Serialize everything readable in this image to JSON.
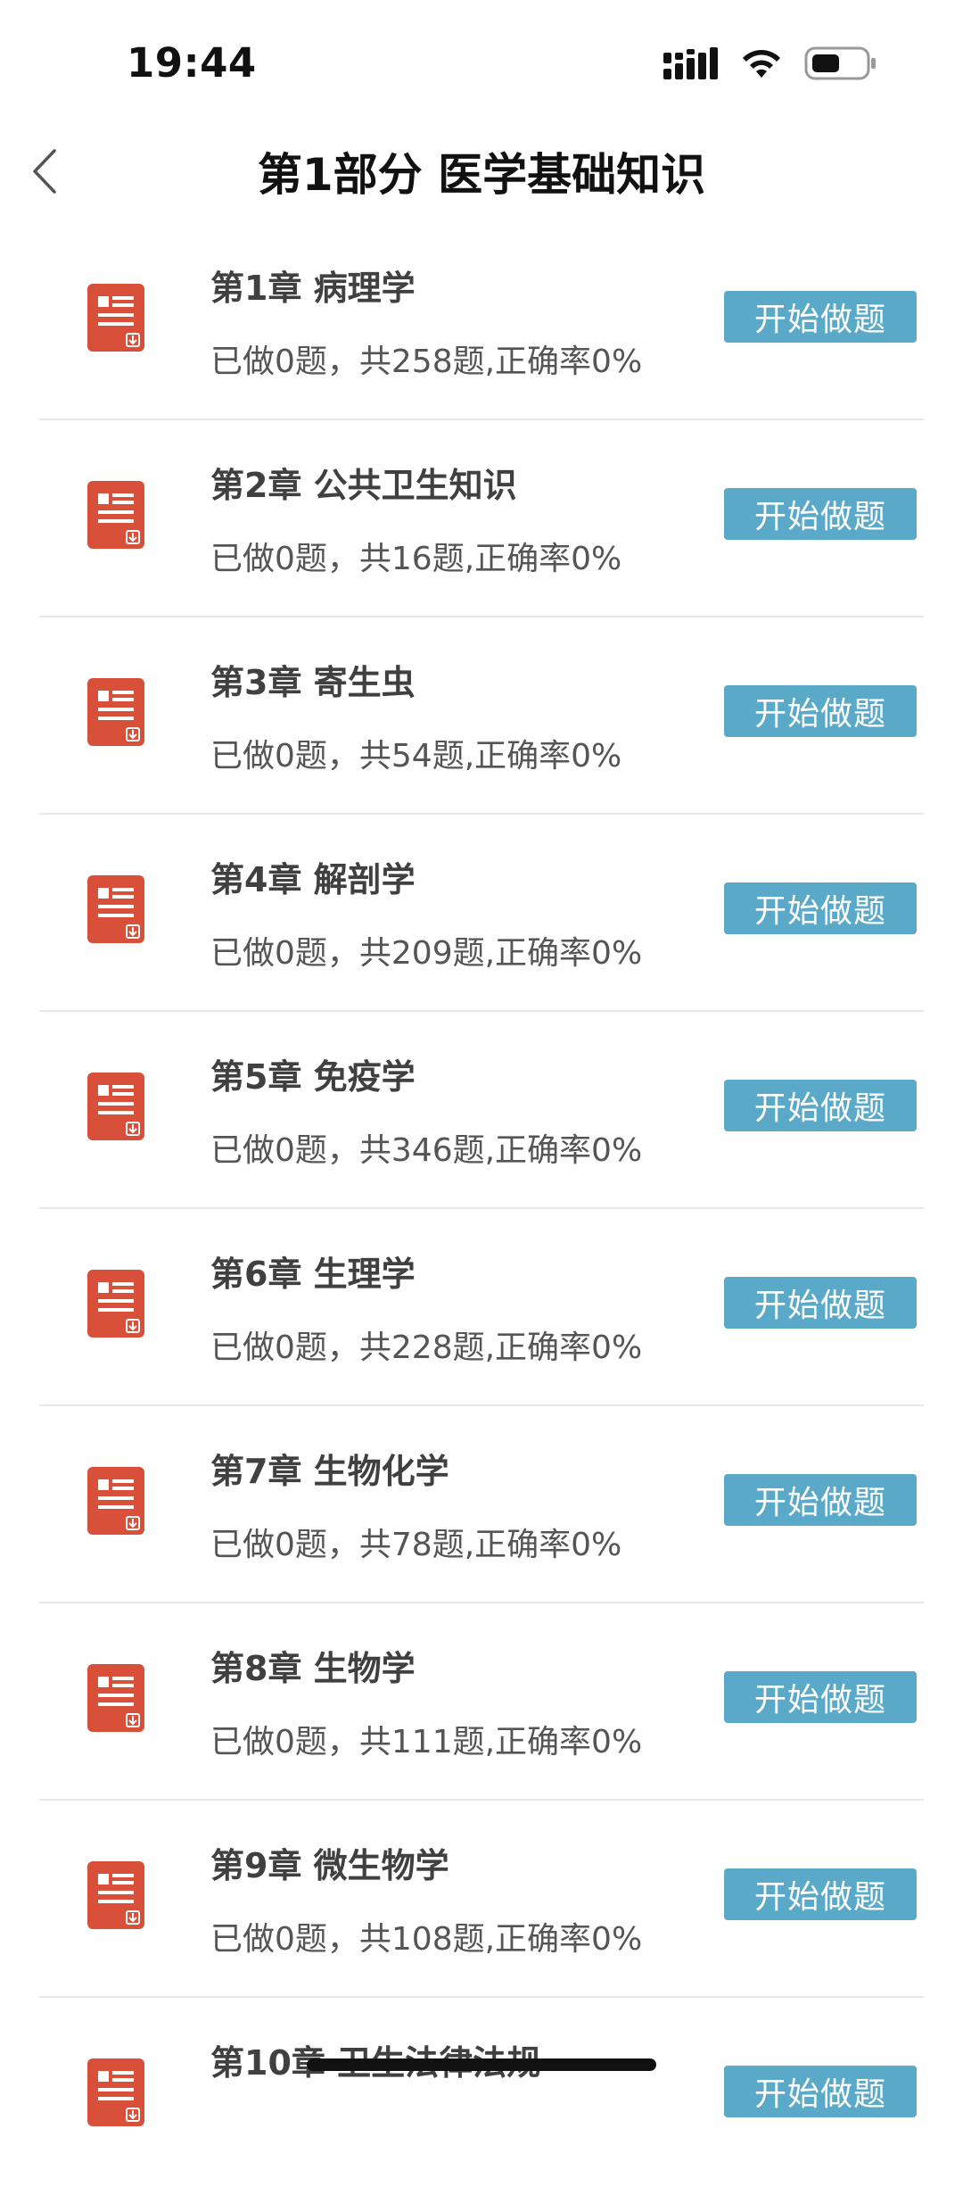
{
  "status_bar": {
    "time": "19:44"
  },
  "header": {
    "title": "第1部分 医学基础知识"
  },
  "chapters": [
    {
      "title": "第1章  病理学",
      "stats": "已做0题，共258题,正确率0%",
      "button": "开始做题"
    },
    {
      "title": "第2章  公共卫生知识",
      "stats": "已做0题，共16题,正确率0%",
      "button": "开始做题"
    },
    {
      "title": "第3章  寄生虫",
      "stats": "已做0题，共54题,正确率0%",
      "button": "开始做题"
    },
    {
      "title": "第4章  解剖学",
      "stats": "已做0题，共209题,正确率0%",
      "button": "开始做题"
    },
    {
      "title": "第5章  免疫学",
      "stats": "已做0题，共346题,正确率0%",
      "button": "开始做题"
    },
    {
      "title": "第6章  生理学",
      "stats": "已做0题，共228题,正确率0%",
      "button": "开始做题"
    },
    {
      "title": "第7章  生物化学",
      "stats": "已做0题，共78题,正确率0%",
      "button": "开始做题"
    },
    {
      "title": "第8章  生物学",
      "stats": "已做0题，共111题,正确率0%",
      "button": "开始做题"
    },
    {
      "title": "第9章  微生物学",
      "stats": "已做0题，共108题,正确率0%",
      "button": "开始做题"
    },
    {
      "title": "第10章  卫生法律法规",
      "stats": "",
      "button": "开始做题"
    }
  ],
  "icons": {
    "back": "chevron-left-icon",
    "signal": "cellular-signal-icon",
    "wifi": "wifi-icon",
    "battery": "battery-icon",
    "document": "document-icon"
  },
  "colors": {
    "button_bg": "#5ba9c9",
    "icon_red": "#d9503a",
    "text_dark": "#333333"
  }
}
